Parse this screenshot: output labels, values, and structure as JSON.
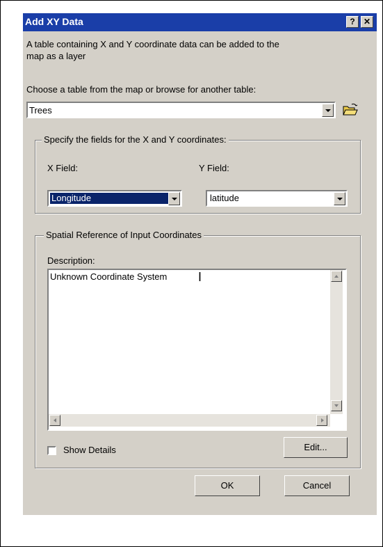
{
  "dialog": {
    "title": "Add XY Data",
    "help_label": "?",
    "close_label": "✕",
    "intro_text_line1": "A table containing X and Y coordinate data can be added to the",
    "intro_text_line2": "map as a layer",
    "choose_label": "Choose a table from the map or browse for another table:",
    "table_value": "Trees"
  },
  "fields_group": {
    "legend": "Specify the fields for the X and Y coordinates:",
    "x_label": "X Field:",
    "x_value": "Longitude",
    "y_label": "Y Field:",
    "y_value": "latitude"
  },
  "spatial_group": {
    "legend": "Spatial Reference of Input Coordinates",
    "description_label": "Description:",
    "description_value": "Unknown Coordinate System",
    "show_details_label": "Show Details",
    "edit_button": "Edit..."
  },
  "buttons": {
    "ok": "OK",
    "cancel": "Cancel"
  },
  "colors": {
    "titlebar": "#1a3ea8",
    "selection": "#0a246a",
    "dialog_bg": "#d4d0c8"
  },
  "icons": {
    "browse": "open-folder-icon"
  }
}
